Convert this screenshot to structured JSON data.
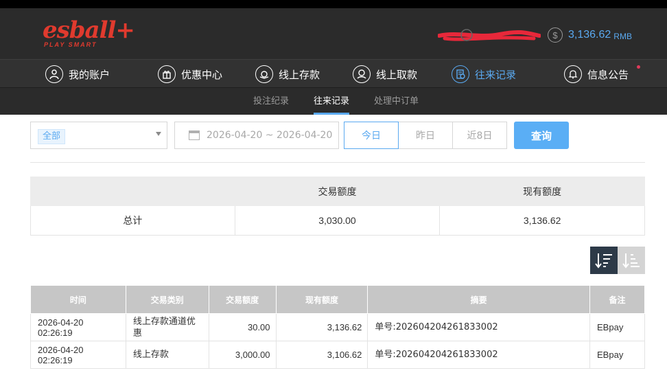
{
  "brand": {
    "name": "esball+",
    "tagline": "PLAY SMART"
  },
  "account": {
    "currency_icon": "$",
    "balance": "3,136.62",
    "currency": "RMB"
  },
  "nav": [
    {
      "label": "我的账户",
      "icon": "user-icon"
    },
    {
      "label": "优惠中心",
      "icon": "gift-icon"
    },
    {
      "label": "线上存款",
      "icon": "deposit-icon"
    },
    {
      "label": "线上取款",
      "icon": "withdraw-icon"
    },
    {
      "label": "往来记录",
      "icon": "records-icon",
      "active": true
    },
    {
      "label": "信息公告",
      "icon": "bell-icon"
    }
  ],
  "subnav": [
    {
      "label": "投注纪录"
    },
    {
      "label": "往来记录",
      "active": true
    },
    {
      "label": "处理中订单"
    }
  ],
  "filter": {
    "type_selected": "全部",
    "date_range": "2026-04-20 ~ 2026-04-20",
    "quick_ranges": [
      "今日",
      "昨日",
      "近8日"
    ],
    "active_range": "今日",
    "query_label": "查询"
  },
  "summary": {
    "headers": [
      "",
      "交易额度",
      "现有额度"
    ],
    "row": [
      "总计",
      "3,030.00",
      "3,136.62"
    ]
  },
  "records": {
    "headers": [
      "时间",
      "交易类别",
      "交易额度",
      "现有额度",
      "摘要",
      "备注"
    ],
    "rows": [
      [
        "2026-04-20 02:26:19",
        "线上存款通道优惠",
        "30.00",
        "3,136.62",
        "单号:202604204261833002",
        "EBpay"
      ],
      [
        "2026-04-20 02:26:19",
        "线上存款",
        "3,000.00",
        "3,106.62",
        "单号:202604204261833002",
        "EBpay"
      ]
    ]
  },
  "colors": {
    "accent": "#5aa9f0",
    "brand": "#e03a2e",
    "header_bg": "#2b2b2b",
    "nav_bg": "#323232"
  }
}
